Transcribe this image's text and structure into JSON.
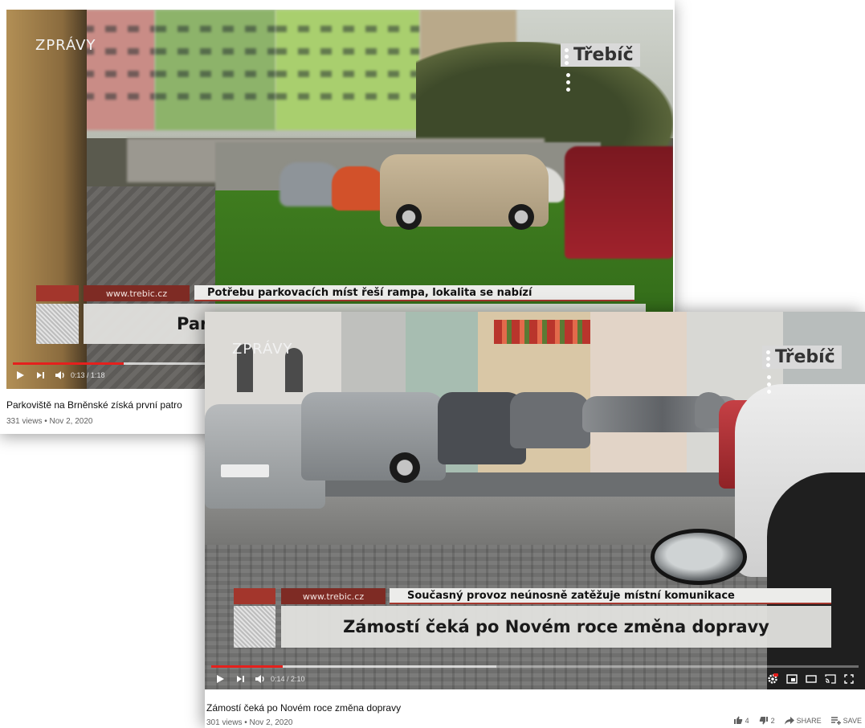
{
  "back_video": {
    "channel_logo": "ZPRÁVY",
    "city_logo": "Třebíč",
    "lower_third": {
      "url": "www.trebic.cz",
      "subtitle": "Potřebu parkovacích míst řeší rampa, lokalita se nabízí",
      "headline": "Parkoviště na Brněnské získá první patro",
      "headline_visible": "Par"
    },
    "player": {
      "time": "0:13 / 1:18",
      "progress": 0.17,
      "buffered": 0.42
    },
    "title": "Parkoviště na Brněnské získá první patro",
    "meta": "331 views • Nov 2, 2020"
  },
  "front_video": {
    "channel_logo": "ZPRÁVY",
    "city_logo": "Třebíč",
    "lower_third": {
      "url": "www.trebic.cz",
      "subtitle": "Současný provoz neúnosně zatěžuje místní komunikace",
      "headline": "Zámostí čeká po Novém roce změna dopravy"
    },
    "player": {
      "time": "0:14 / 2:10",
      "progress": 0.11,
      "buffered": 0.44
    },
    "title": "Zámostí čeká po Novém roce změna dopravy",
    "meta": "301 views • Nov 2, 2020",
    "actions": {
      "likes": "4",
      "dislikes": "2",
      "share": "SHARE",
      "save": "SAVE"
    }
  },
  "icons": [
    "play-icon",
    "next-icon",
    "volume-icon",
    "settings-icon",
    "miniplayer-icon",
    "theater-icon",
    "cast-icon",
    "fullscreen-icon",
    "like-icon",
    "dislike-icon",
    "share-icon",
    "save-icon"
  ],
  "colors": {
    "progress": "#e5201d",
    "lower_third_red": "#a3362c"
  }
}
